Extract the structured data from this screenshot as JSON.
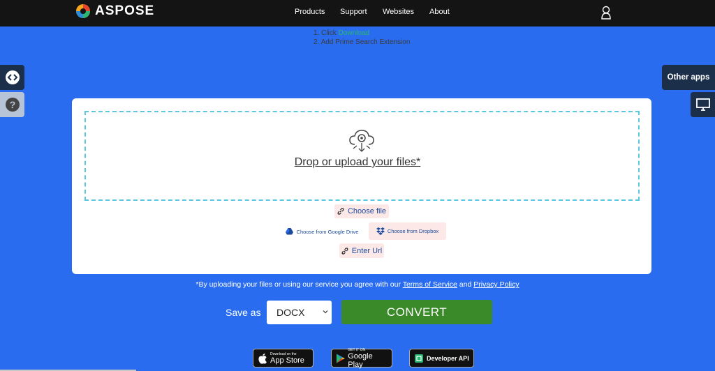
{
  "header": {
    "brand": "ASPOSE",
    "nav": [
      "Products",
      "Support",
      "Websites",
      "About"
    ]
  },
  "promo": {
    "line1_prefix": "1. Click ",
    "line1_link": "Download",
    "line2": "2. Add Prime Search Extension"
  },
  "side": {
    "other_apps": "Other apps"
  },
  "upload": {
    "drop_text": "Drop or upload your files*",
    "choose_file": "Choose file",
    "google_drive": "Choose from Google Drive",
    "dropbox": "Choose from Dropbox",
    "enter_url": "Enter Url"
  },
  "terms": {
    "prefix": "*By uploading your files or using our service you agree with our ",
    "tos": "Terms of Service",
    "and": " and ",
    "privacy": "Privacy Policy"
  },
  "convert": {
    "save_as_label": "Save as",
    "format": "DOCX",
    "button": "CONVERT"
  },
  "stores": {
    "appstore_small": "Download on the",
    "appstore_big": "App Store",
    "play_small": "GET IT ON",
    "play_big": "Google Play",
    "api": "Developer API"
  },
  "colors": {
    "background": "#2a6cf0",
    "header": "#141414",
    "convert": "#3a8a2a",
    "dashed_border": "#5ac8e0"
  }
}
